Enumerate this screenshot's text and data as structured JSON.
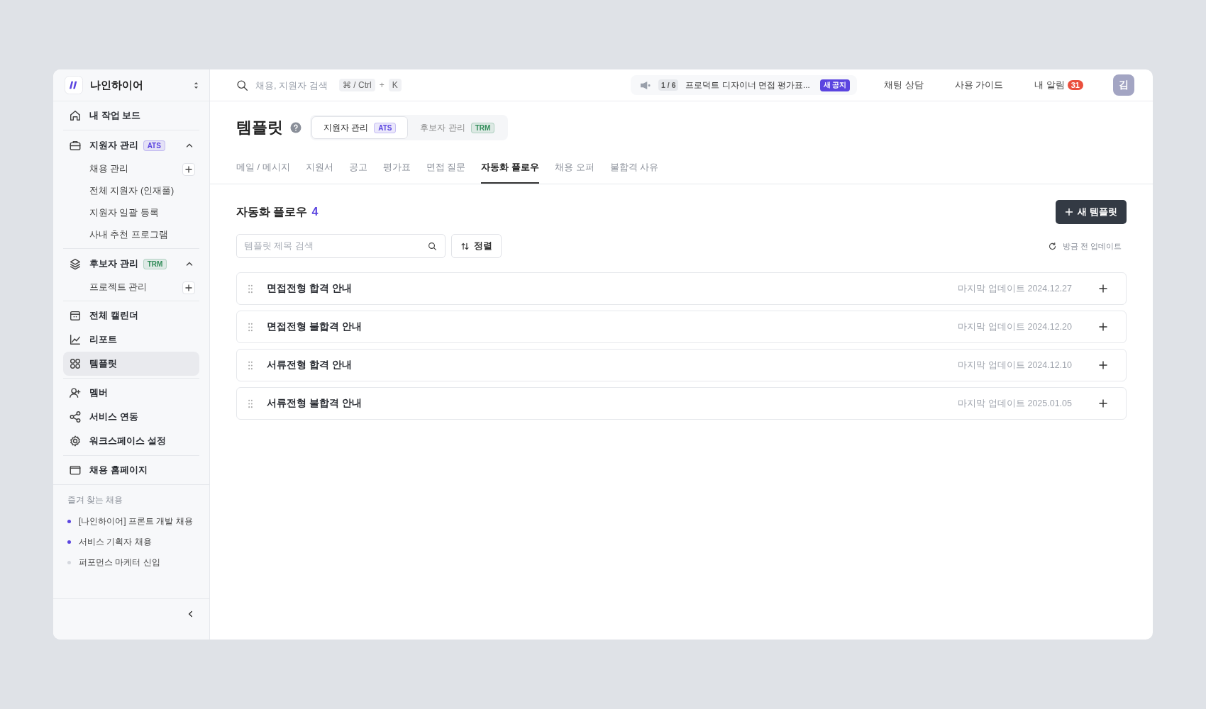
{
  "workspace": {
    "name": "나인하이어"
  },
  "sidebar": {
    "sections": [
      {
        "kind": "links",
        "items": [
          {
            "label": "내 작업 보드",
            "selected": false
          }
        ]
      },
      {
        "kind": "group",
        "label": "지원자 관리",
        "badge": "ATS",
        "color": "#5b45e0",
        "expanded": true,
        "items": [
          {
            "label": "채용 관리",
            "addable": true,
            "selected": false
          },
          {
            "label": "전체 지원자 (인재풀)",
            "addable": false,
            "selected": false
          },
          {
            "label": "지원자 일괄 등록",
            "addable": false,
            "selected": false
          },
          {
            "label": "사내 추천 프로그램",
            "addable": false,
            "selected": false
          }
        ]
      },
      {
        "kind": "group",
        "label": "후보자 관리",
        "badge": "TRM",
        "color": "#2e8b57",
        "expanded": true,
        "items": [
          {
            "label": "프로젝트 관리",
            "addable": true,
            "selected": false
          }
        ]
      },
      {
        "kind": "links",
        "items": [
          {
            "label": "전체 캘린더",
            "selected": false
          },
          {
            "label": "리포트",
            "selected": false
          },
          {
            "label": "템플릿",
            "selected": true
          }
        ]
      },
      {
        "kind": "links",
        "items": [
          {
            "label": "멤버",
            "selected": false
          },
          {
            "label": "서비스 연동",
            "selected": false
          },
          {
            "label": "워크스페이스 설정",
            "selected": false
          }
        ]
      },
      {
        "kind": "links",
        "items": [
          {
            "label": "채용 홈페이지",
            "selected": false
          }
        ]
      }
    ],
    "favorites": {
      "title": "즐겨 찾는 채용",
      "items": [
        {
          "label": "[나인하이어] 프론트 개발 채용",
          "color": "#5b45e0"
        },
        {
          "label": "서비스 기획자 채용",
          "color": "#5b45e0"
        },
        {
          "label": "퍼포먼스 마케터 신입",
          "color": "#d5d8de"
        }
      ]
    }
  },
  "topbar": {
    "search": {
      "placeholder": "채용, 지원자 검색",
      "keys": [
        "⌘ / Ctrl",
        "K"
      ],
      "joiner": "+"
    },
    "notice": {
      "counter": "1 / 6",
      "text": "프로덕트 디자이너 면접 평가표...",
      "badge": "새 공지"
    },
    "links": [
      {
        "label": "채팅 상담"
      },
      {
        "label": "사용 가이드"
      },
      {
        "label": "내 알림",
        "count": "31"
      }
    ],
    "avatar": "김"
  },
  "page": {
    "title": "템플릿",
    "scopes": [
      {
        "label": "지원자 관리",
        "badge": "ATS",
        "color": "#5b45e0",
        "selected": true
      },
      {
        "label": "후보자 관리",
        "badge": "TRM",
        "color": "#2e8b57",
        "selected": false
      }
    ],
    "tabs": [
      {
        "label": "메일 / 메시지",
        "selected": false
      },
      {
        "label": "지원서",
        "selected": false
      },
      {
        "label": "공고",
        "selected": false
      },
      {
        "label": "평가표",
        "selected": false
      },
      {
        "label": "면접 질문",
        "selected": false
      },
      {
        "label": "자동화 플로우",
        "selected": true
      },
      {
        "label": "채용 오퍼",
        "selected": false
      },
      {
        "label": "불합격 사유",
        "selected": false
      }
    ],
    "section": {
      "title": "자동화 플로우",
      "count": "4"
    },
    "new_button": "새 템플릿",
    "search_placeholder": "템플릿 제목 검색",
    "sort": "정렬",
    "refresh": "방금 전 업데이트",
    "rows": [
      {
        "title": "면접전형 합격 안내",
        "updated": "마지막 업데이트 2024.12.27"
      },
      {
        "title": "면접전형 불합격 안내",
        "updated": "마지막 업데이트 2024.12.20"
      },
      {
        "title": "서류전형 합격 안내",
        "updated": "마지막 업데이트 2024.12.10"
      },
      {
        "title": "서류전형 불합격 안내",
        "updated": "마지막 업데이트 2025.01.05"
      }
    ]
  }
}
